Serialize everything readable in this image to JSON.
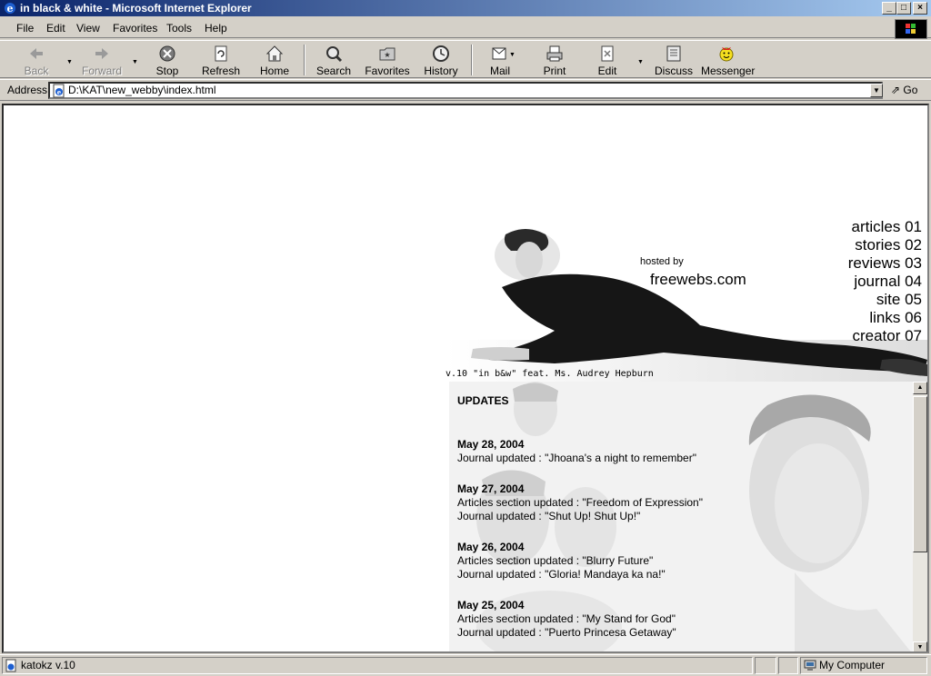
{
  "window": {
    "title": "in black & white - Microsoft Internet Explorer",
    "minimize": "_",
    "maximize": "□",
    "close": "×"
  },
  "menu": {
    "file": "File",
    "edit": "Edit",
    "view": "View",
    "favorites": "Favorites",
    "tools": "Tools",
    "help": "Help"
  },
  "toolbar": {
    "back": "Back",
    "forward": "Forward",
    "stop": "Stop",
    "refresh": "Refresh",
    "home": "Home",
    "search": "Search",
    "favorites": "Favorites",
    "history": "History",
    "mail": "Mail",
    "print": "Print",
    "edit": "Edit",
    "discuss": "Discuss",
    "messenger": "Messenger"
  },
  "address": {
    "label": "Address",
    "value": "D:\\KAT\\new_webby\\index.html",
    "go": "Go"
  },
  "page": {
    "hosted_by": "hosted by",
    "host": "freewebs.com",
    "caption": "v.10 \"in b&w\" feat. Ms. Audrey Hepburn",
    "nav": [
      {
        "label": "articles 01"
      },
      {
        "label": "stories 02"
      },
      {
        "label": "reviews 03"
      },
      {
        "label": "journal 04"
      },
      {
        "label": "site 05"
      },
      {
        "label": "links 06"
      },
      {
        "label": "creator 07"
      }
    ],
    "updates": {
      "title": "UPDATES",
      "entries": [
        {
          "date": "May 28, 2004",
          "lines": [
            "Journal updated : \"Jhoana's a night to remember\""
          ]
        },
        {
          "date": "May 27, 2004",
          "lines": [
            "Articles section updated : \"Freedom of Expression\"",
            "Journal updated : \"Shut Up! Shut Up!\""
          ]
        },
        {
          "date": "May 26, 2004",
          "lines": [
            "Articles section updated : \"Blurry Future\"",
            "Journal updated : \"Gloria! Mandaya ka na!\""
          ]
        },
        {
          "date": "May 25, 2004",
          "lines": [
            "Articles section updated : \"My Stand for God\"",
            "Journal updated : \"Puerto Princesa Getaway\""
          ]
        }
      ]
    }
  },
  "status": {
    "text": "katokz v.10",
    "zone": "My Computer"
  }
}
